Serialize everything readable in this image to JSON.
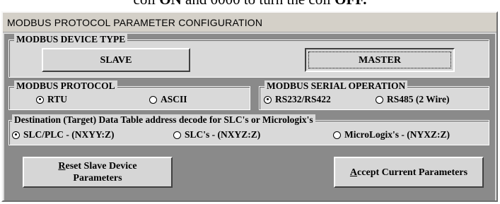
{
  "caption": {
    "part1": "coil ",
    "on": "ON",
    "part2": " and 0000 to turn the coil ",
    "off": "OFF."
  },
  "window": {
    "title": "MODBUS PROTOCOL PARAMETER CONFIGURATION"
  },
  "device_type": {
    "label": "MODBUS DEVICE TYPE",
    "slave": "SLAVE",
    "master": "MASTER",
    "selected": "MASTER"
  },
  "protocol": {
    "label": "MODBUS PROTOCOL",
    "options": [
      "RTU",
      "ASCII"
    ],
    "selected": "RTU"
  },
  "serial": {
    "label": "MODBUS SERIAL OPERATION",
    "options": [
      "RS232/RS422",
      "RS485 (2 Wire)"
    ],
    "selected": "RS232/RS422"
  },
  "address": {
    "label": "Destination (Target) Data Table address decode for SLC's or Micrologix's",
    "options": [
      "SLC/PLC - (NXYY:Z)",
      "SLC's - (NXYZ:Z)",
      "MicroLogix's - (NYXZ:Z)"
    ],
    "selected": "SLC/PLC - (NXYY:Z)"
  },
  "buttons": {
    "reset_mnemonic": "R",
    "reset_line1_rest": "eset Slave Device",
    "reset_line2": "Parameters",
    "accept_mnemonic": "A",
    "accept_rest": "ccept Current Parameters"
  }
}
